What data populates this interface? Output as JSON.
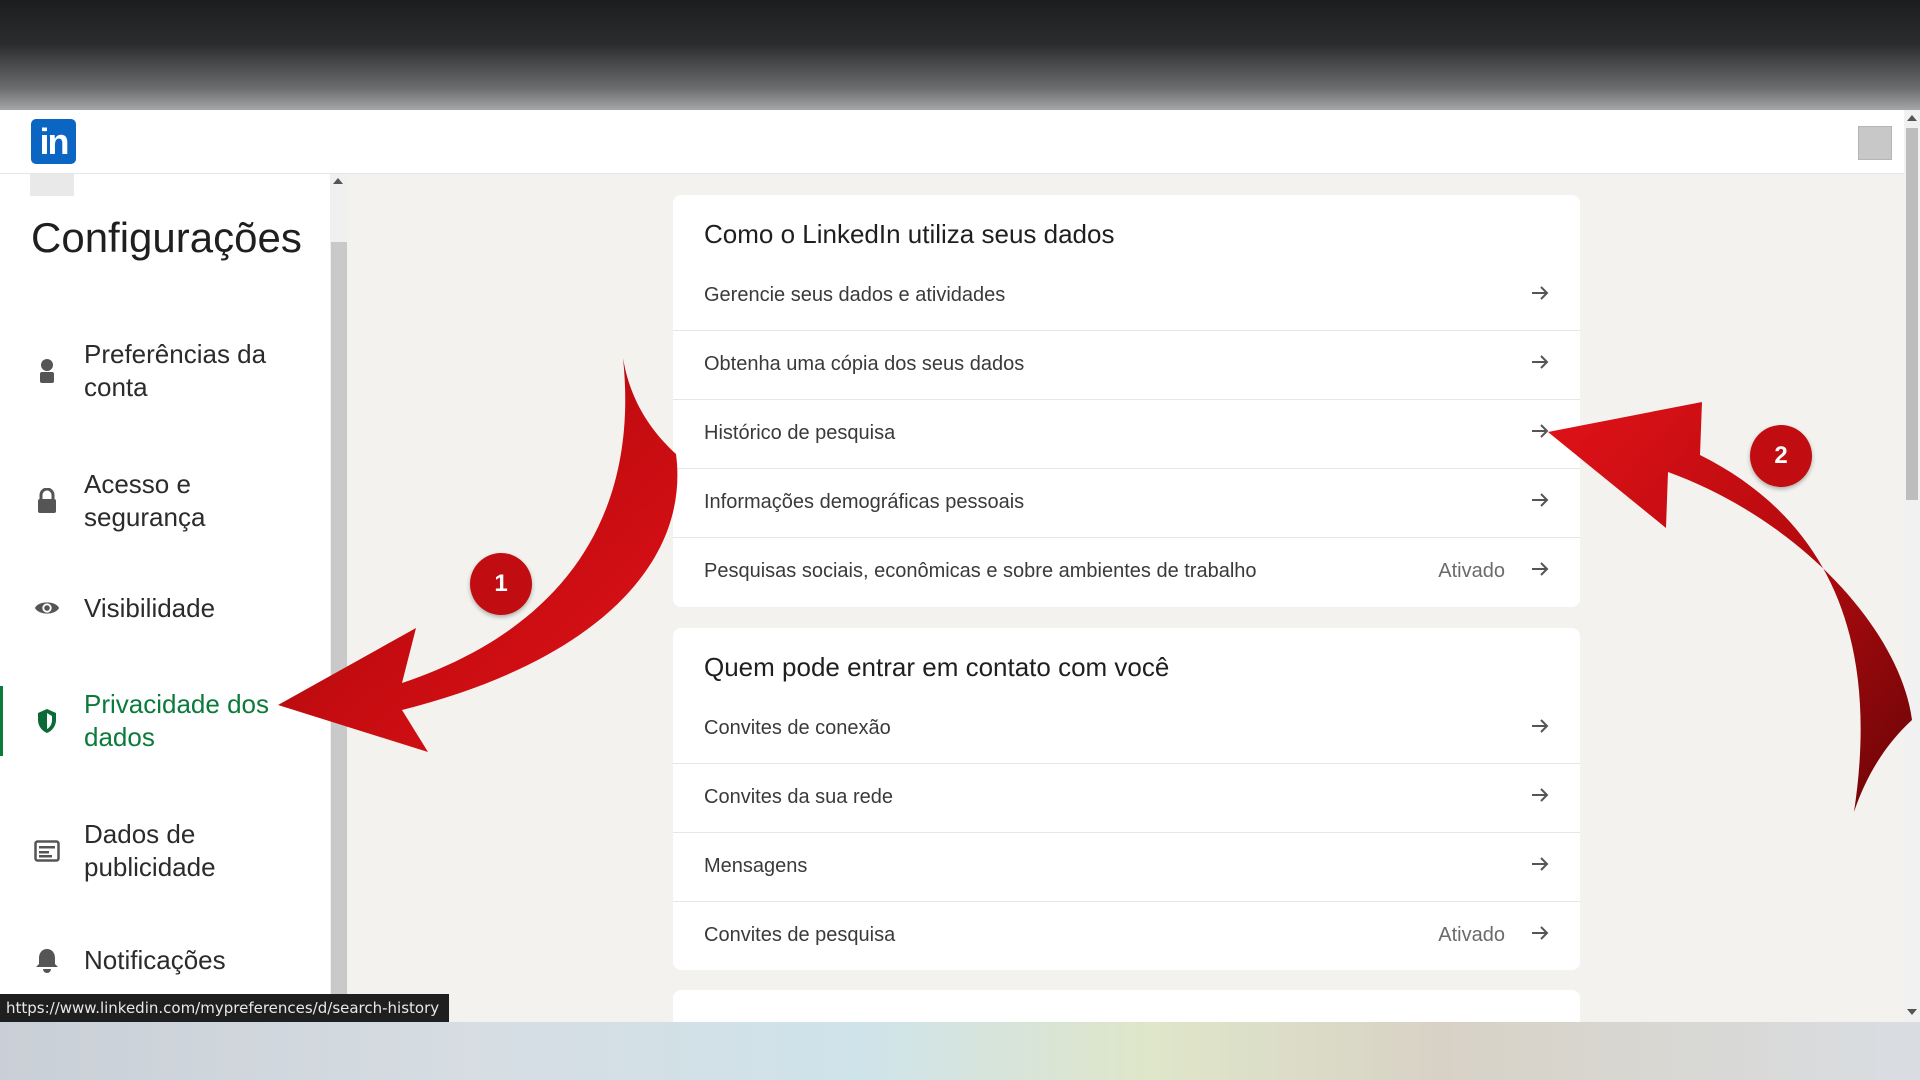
{
  "header": {
    "logo_text": "in"
  },
  "sidebar": {
    "title": "Configurações",
    "items": [
      {
        "label": "Preferências da conta",
        "icon": "person-icon",
        "active": false
      },
      {
        "label": "Acesso e segurança",
        "icon": "lock-icon",
        "active": false
      },
      {
        "label": "Visibilidade",
        "icon": "eye-icon",
        "active": false
      },
      {
        "label": "Privacidade dos dados",
        "icon": "shield-icon",
        "active": true
      },
      {
        "label": "Dados de publicidade",
        "icon": "ad-card-icon",
        "active": false
      },
      {
        "label": "Notificações",
        "icon": "bell-icon",
        "active": false
      }
    ]
  },
  "main": {
    "sections": [
      {
        "title": "Como o LinkedIn utiliza seus dados",
        "rows": [
          {
            "label": "Gerencie seus dados e atividades",
            "status": ""
          },
          {
            "label": "Obtenha uma cópia dos seus dados",
            "status": ""
          },
          {
            "label": "Histórico de pesquisa",
            "status": ""
          },
          {
            "label": "Informações demográficas pessoais",
            "status": ""
          },
          {
            "label": "Pesquisas sociais, econômicas e sobre ambientes de trabalho",
            "status": "Ativado"
          }
        ]
      },
      {
        "title": "Quem pode entrar em contato com você",
        "rows": [
          {
            "label": "Convites de conexão",
            "status": ""
          },
          {
            "label": "Convites da sua rede",
            "status": ""
          },
          {
            "label": "Mensagens",
            "status": ""
          },
          {
            "label": "Convites de pesquisa",
            "status": "Ativado"
          }
        ]
      }
    ]
  },
  "status_bar": {
    "url": "https://www.linkedin.com/mypreferences/d/search-history"
  },
  "annotations": {
    "badge_1": "1",
    "badge_2": "2",
    "color": "#c10d12"
  },
  "colors": {
    "linkedin_blue": "#0a66c2",
    "active_green": "#0b7a3b",
    "page_bg": "#f4f2ee"
  }
}
